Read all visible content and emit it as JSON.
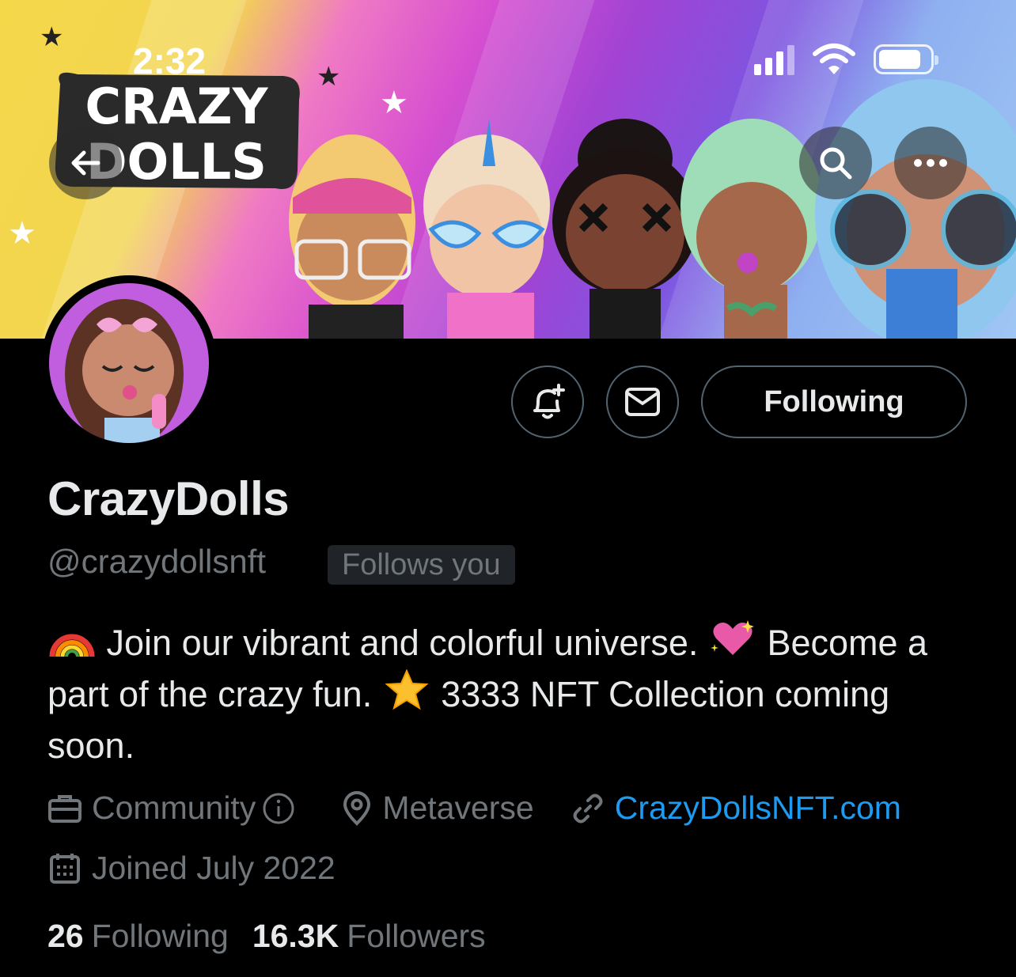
{
  "status_bar": {
    "time": "2:32"
  },
  "banner": {
    "logo_line1": "CRAZY",
    "logo_line2": "DOLLS"
  },
  "profile": {
    "name": "CrazyDolls",
    "handle": "@crazydollsnft",
    "follows_you_badge": "Follows you",
    "following_button_label": "Following",
    "bio": {
      "part1": "Join our vibrant and colorful universe.",
      "part2": "Become a part of the crazy fun.",
      "part3": "3333 NFT Collection coming soon."
    },
    "category": "Community",
    "location": "Metaverse",
    "website": "CrazyDollsNFT.com",
    "joined": "Joined July 2022",
    "stats": {
      "following_count": "26",
      "following_label": "Following",
      "followers_count": "16.3K",
      "followers_label": "Followers"
    }
  },
  "icons": {
    "back": "arrow-left-icon",
    "search": "search-icon",
    "more": "more-horizontal-icon",
    "notify": "bell-plus-icon",
    "message": "envelope-icon",
    "category": "briefcase-icon",
    "info": "info-icon",
    "location": "location-pin-icon",
    "website": "link-icon",
    "joined": "calendar-icon"
  },
  "colors": {
    "background": "#000000",
    "text": "#e7e9ea",
    "muted": "#71767b",
    "link": "#1d9bf0",
    "border": "#536471"
  }
}
